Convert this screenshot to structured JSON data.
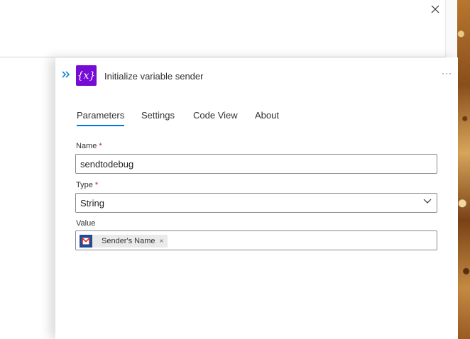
{
  "icons": {
    "close": "close-icon",
    "expand": "double-chevron-right-icon",
    "variable": "variable-icon",
    "more": "more-icon",
    "chevron": "chevron-down-icon",
    "gmail": "gmail-icon"
  },
  "colors": {
    "accent": "#0078d4",
    "variable_icon_bg": "#770bd6",
    "required": "#a4262c",
    "token_bg": "#eaeaea",
    "gmail_bg": "#1f4c97"
  },
  "panel": {
    "title": "Initialize variable sender",
    "variable_glyph": "{x}",
    "more_glyph": "···",
    "tabs": [
      {
        "label": "Parameters",
        "active": true
      },
      {
        "label": "Settings",
        "active": false
      },
      {
        "label": "Code View",
        "active": false
      },
      {
        "label": "About",
        "active": false
      }
    ]
  },
  "form": {
    "name": {
      "label": "Name",
      "required_mark": "*",
      "value": "sendtodebug"
    },
    "type": {
      "label": "Type",
      "required_mark": "*",
      "selected": "String"
    },
    "value": {
      "label": "Value",
      "token_label": "Sender's Name",
      "token_remove": "×"
    }
  }
}
